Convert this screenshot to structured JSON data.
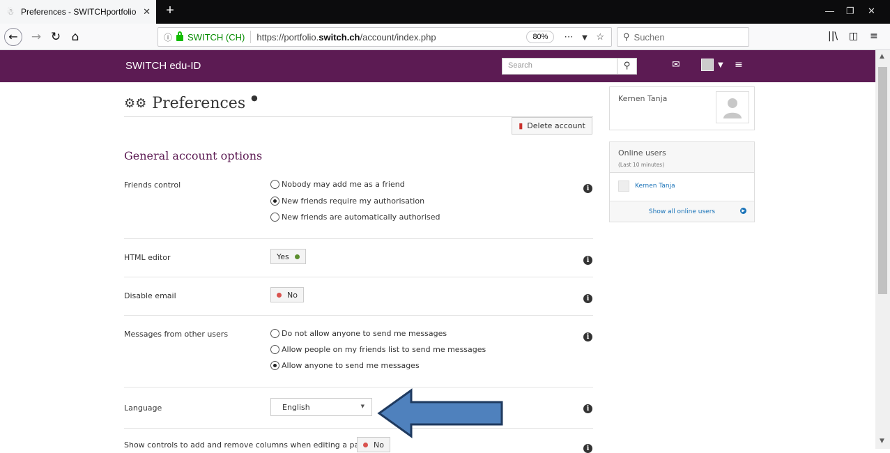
{
  "browser": {
    "tab_title": "Preferences - SWITCHportfolio",
    "url_identity": "SWITCH (CH)",
    "url_prefix": "https://portfolio.",
    "url_domain": "switch.ch",
    "url_path": "/account/index.php",
    "zoom": "80%",
    "search_placeholder": "Suchen"
  },
  "site": {
    "title": "SWITCH edu-ID",
    "search_placeholder": "Search",
    "header_color": "#5c1b53"
  },
  "page": {
    "title": "Preferences",
    "delete_account": "Delete account",
    "section_heading": "General account options"
  },
  "settings": {
    "friends_control": {
      "label": "Friends control",
      "options": [
        "Nobody may add me as a friend",
        "New friends require my authorisation",
        "New friends are automatically authorised"
      ],
      "selected": 1
    },
    "html_editor": {
      "label": "HTML editor",
      "value": "Yes"
    },
    "disable_email": {
      "label": "Disable email",
      "value": "No"
    },
    "messages": {
      "label": "Messages from other users",
      "options": [
        "Do not allow anyone to send me messages",
        "Allow people on my friends list to send me messages",
        "Allow anyone to send me messages"
      ],
      "selected": 2
    },
    "language": {
      "label": "Language",
      "value": "English"
    },
    "columns_controls": {
      "label": "Show controls to add and remove columns when editing a page",
      "value": "No"
    }
  },
  "sidebar": {
    "profile_name": "Kernen Tanja",
    "online_title": "Online users",
    "online_sub": "(Last 10 minutes)",
    "online_user": "Kernen Tanja",
    "show_all": "Show all online users"
  }
}
